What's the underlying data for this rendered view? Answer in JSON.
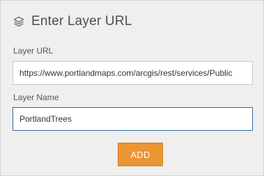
{
  "dialog": {
    "title": "Enter Layer URL",
    "icon": "layers-icon"
  },
  "form": {
    "url_label": "Layer URL",
    "url_value": "https://www.portlandmaps.com/arcgis/rest/services/Public",
    "name_label": "Layer Name",
    "name_value": "PortlandTrees"
  },
  "actions": {
    "add_label": "ADD"
  },
  "colors": {
    "accent_button": "#ec9533",
    "focus_border": "#2b6ca3",
    "panel_bg": "#efefef"
  }
}
